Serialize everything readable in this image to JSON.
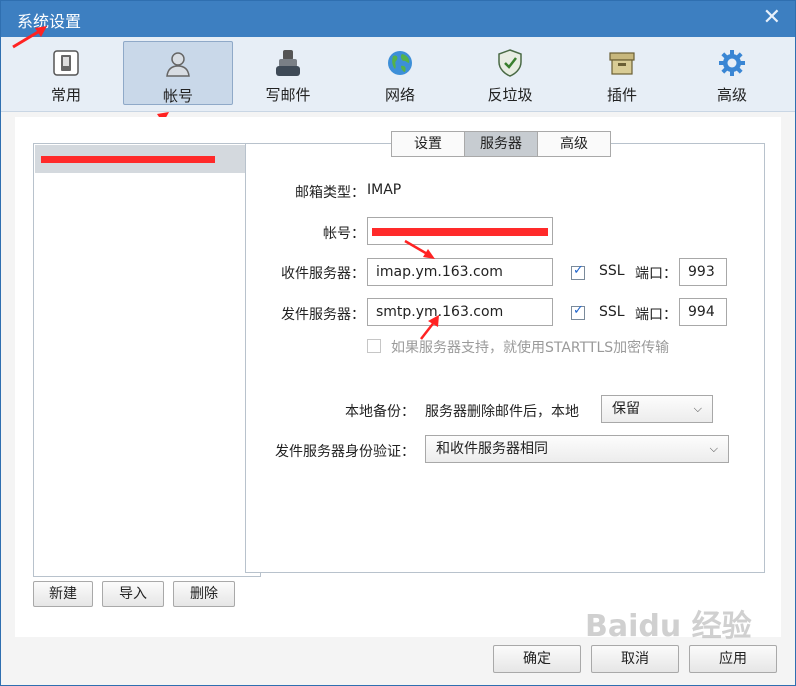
{
  "window": {
    "title": "系统设置",
    "close_glyph": "✕"
  },
  "toolbar": {
    "items": [
      {
        "label": "常用",
        "icon": "phone-icon"
      },
      {
        "label": "帐号",
        "icon": "user-icon",
        "active": true
      },
      {
        "label": "写邮件",
        "icon": "pen-ink-icon"
      },
      {
        "label": "网络",
        "icon": "globe-icon"
      },
      {
        "label": "反垃圾",
        "icon": "shield-icon"
      },
      {
        "label": "插件",
        "icon": "box-icon"
      },
      {
        "label": "高级",
        "icon": "gear-icon"
      }
    ]
  },
  "account_list": {
    "buttons": {
      "new": "新建",
      "import": "导入",
      "delete": "删除"
    }
  },
  "tabs": [
    {
      "label": "设置"
    },
    {
      "label": "服务器",
      "active": true
    },
    {
      "label": "高级"
    }
  ],
  "server": {
    "mailbox_type_label": "邮箱类型：",
    "mailbox_type_value": "IMAP",
    "account_label": "帐号：",
    "incoming_label": "收件服务器：",
    "incoming_value": "imap.ym.163.com",
    "incoming_ssl_label": "SSL",
    "incoming_port_label": "端口：",
    "incoming_port": "993",
    "outgoing_label": "发件服务器：",
    "outgoing_value": "smtp.ym.163.com",
    "outgoing_ssl_label": "SSL",
    "outgoing_port_label": "端口：",
    "outgoing_port": "994",
    "starttls_label": "如果服务器支持，就使用STARTTLS加密传输",
    "backup_label": "本地备份：",
    "backup_desc": "服务器删除邮件后，本地",
    "backup_value": "保留",
    "auth_label": "发件服务器身份验证：",
    "auth_value": "和收件服务器相同"
  },
  "footer": {
    "ok": "确定",
    "cancel": "取消",
    "apply": "应用"
  },
  "watermark": "Baidu 经验",
  "colors": {
    "titlebar": "#3d7fc1",
    "redaction": "#ff2a2a",
    "check": "#2266cc"
  }
}
